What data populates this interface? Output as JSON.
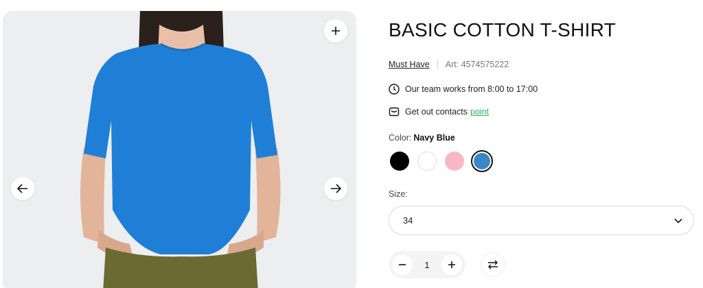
{
  "product": {
    "title": "BASIC COTTON T-SHIRT",
    "brand": "Must Have",
    "article_label": "Art:",
    "article_number": "4574575222",
    "hours_text": "Our team works from 8:00 to 17:00",
    "contacts_text": "Get out contacts",
    "contacts_link": "point",
    "color_label": "Color:",
    "color_value": "Navy Blue",
    "colors": [
      {
        "name": "Black",
        "hex": "#000000"
      },
      {
        "name": "White",
        "hex": "#ffffff"
      },
      {
        "name": "Pink",
        "hex": "#f7b8c4"
      },
      {
        "name": "Navy Blue",
        "hex": "#3b86c6",
        "selected": true
      }
    ],
    "size_label": "Size:",
    "size_value": "34",
    "quantity": "1"
  },
  "gallery": {
    "icons": {
      "zoom": "plus-icon",
      "prev": "arrow-left-icon",
      "next": "arrow-right-icon"
    },
    "shirt_color": "#1f7fd6"
  }
}
